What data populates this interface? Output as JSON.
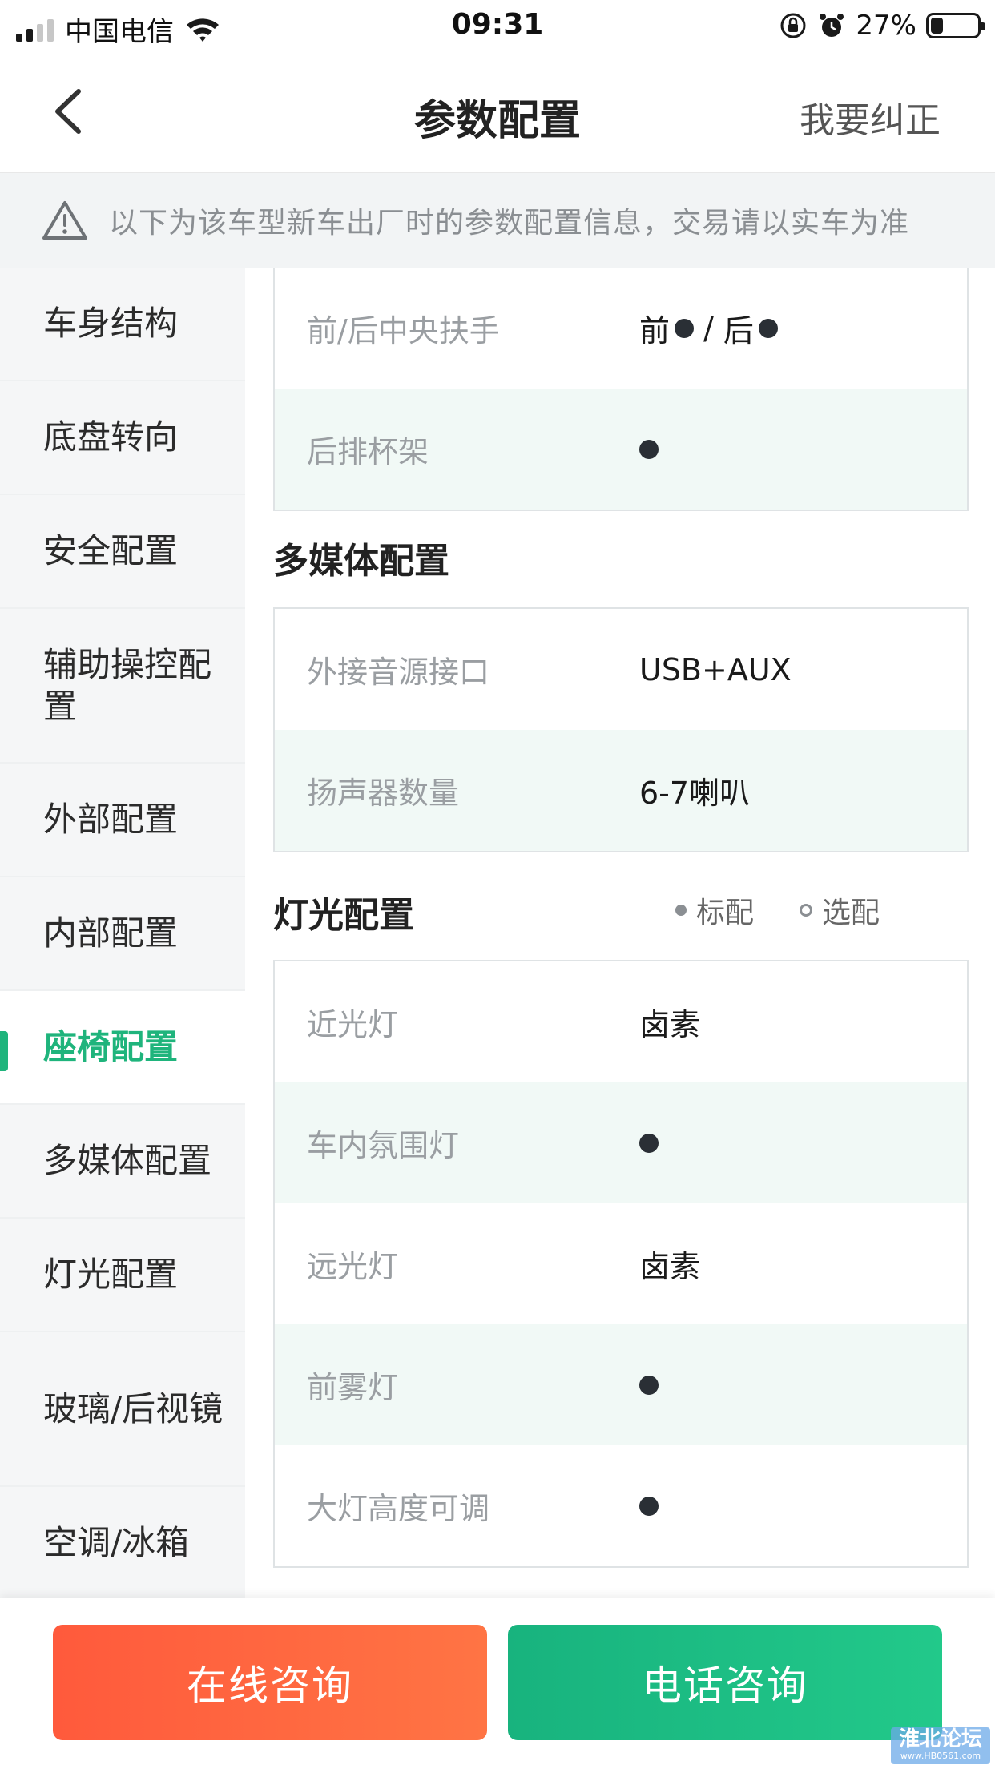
{
  "status_bar": {
    "carrier": "中国电信",
    "time": "09:31",
    "battery_percent": "27%",
    "battery_level": 0.27
  },
  "nav": {
    "title": "参数配置",
    "correct_label": "我要纠正",
    "back_icon": "chevron-left-icon"
  },
  "notice": {
    "icon": "warning-icon",
    "text": "以下为该车型新车出厂时的参数配置信息，交易请以实车为准"
  },
  "sidebar": {
    "items": [
      {
        "label": "车身结构",
        "active": false
      },
      {
        "label": "底盘转向",
        "active": false
      },
      {
        "label": "安全配置",
        "active": false
      },
      {
        "label": "辅助操控配置",
        "active": false
      },
      {
        "label": "外部配置",
        "active": false
      },
      {
        "label": "内部配置",
        "active": false
      },
      {
        "label": "座椅配置",
        "active": true
      },
      {
        "label": "多媒体配置",
        "active": false
      },
      {
        "label": "灯光配置",
        "active": false
      },
      {
        "label": "玻璃/后视镜",
        "active": false
      },
      {
        "label": "空调/冰箱",
        "active": false
      }
    ]
  },
  "seat_rows": [
    {
      "label": "前/后中央扶手",
      "front": "前",
      "sep": "/",
      "rear": "后"
    },
    {
      "label": "后排杯架"
    }
  ],
  "multimedia": {
    "title": "多媒体配置",
    "rows": [
      {
        "label": "外接音源接口",
        "value": "USB+AUX"
      },
      {
        "label": "扬声器数量",
        "value": "6-7喇叭"
      }
    ]
  },
  "lighting": {
    "title": "灯光配置",
    "legend_standard": "标配",
    "legend_optional": "选配",
    "rows": [
      {
        "label": "近光灯",
        "value": "卤素"
      },
      {
        "label": "车内氛围灯"
      },
      {
        "label": "远光灯",
        "value": "卤素"
      },
      {
        "label": "前雾灯"
      },
      {
        "label": "大灯高度可调"
      }
    ]
  },
  "bottom": {
    "online_label": "在线咨询",
    "phone_label": "电话咨询"
  },
  "watermark": {
    "title": "淮北论坛",
    "url": "www.HB0561.com"
  },
  "colors": {
    "accent_green": "#1fb47c",
    "orange": "#ff5a3c"
  }
}
